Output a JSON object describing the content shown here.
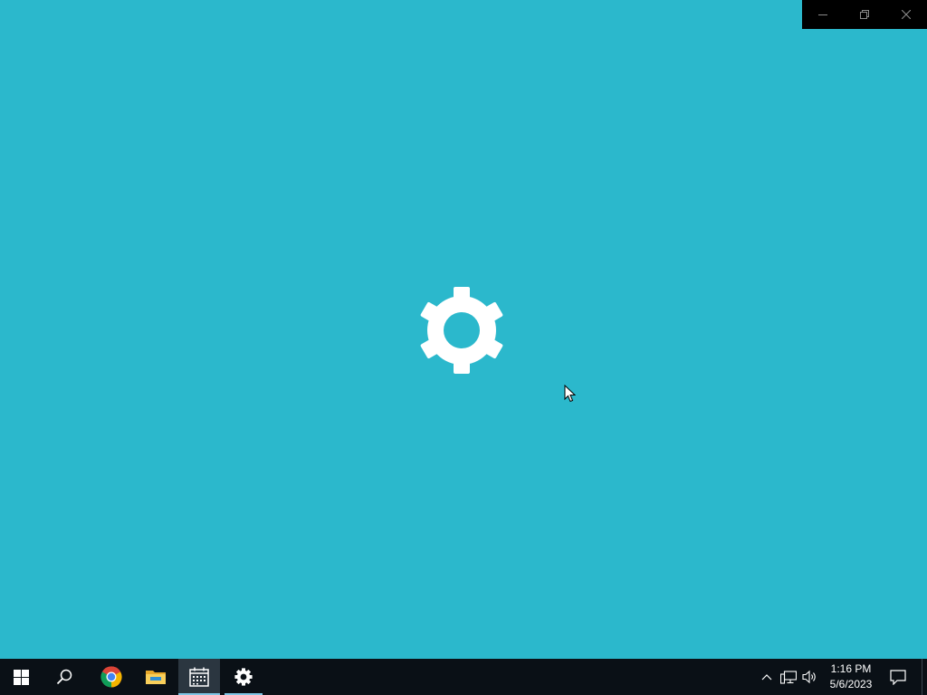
{
  "window": {
    "background_color": "#2bb8cc",
    "splash_icon": "gear-icon",
    "caption_buttons": [
      {
        "name": "minimize",
        "icon": "minimize-icon"
      },
      {
        "name": "restore",
        "icon": "restore-icon"
      },
      {
        "name": "close",
        "icon": "close-icon"
      }
    ]
  },
  "taskbar": {
    "background_color": "#0a1016",
    "pinned": [
      {
        "name": "start",
        "icon": "windows-logo-icon"
      },
      {
        "name": "search",
        "icon": "search-icon"
      },
      {
        "name": "chrome",
        "icon": "chrome-icon"
      },
      {
        "name": "file-explorer",
        "icon": "folder-icon"
      },
      {
        "name": "calendar",
        "icon": "calendar-icon",
        "active": true
      },
      {
        "name": "settings",
        "icon": "gear-icon",
        "running": true
      }
    ],
    "tray": {
      "icons": [
        "chevron-up-icon",
        "network-icon",
        "volume-icon"
      ],
      "time": "1:16 PM",
      "date": "5/6/2023",
      "notifications_icon": "notification-icon"
    }
  }
}
